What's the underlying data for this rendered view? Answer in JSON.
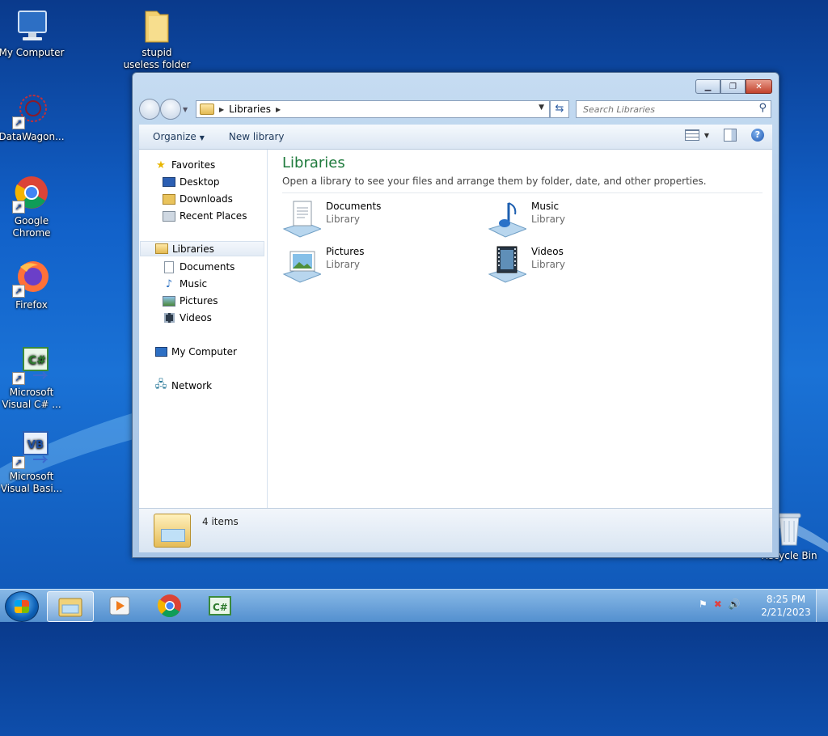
{
  "desktop": {
    "icons": {
      "my_computer": "My Computer",
      "folder": "stupid useless folder",
      "datawagon": "DataWagon...",
      "chrome": "Google Chrome",
      "firefox": "Firefox",
      "csharp": "Microsoft Visual C# ...",
      "vb": "Microsoft Visual Basi...",
      "recycle_bin": "Recycle Bin"
    }
  },
  "explorer": {
    "address": {
      "crumb": "Libraries"
    },
    "search": {
      "placeholder": "Search Libraries"
    },
    "toolbar": {
      "organize": "Organize",
      "new_library": "New library"
    },
    "nav": {
      "favorites": "Favorites",
      "desktop": "Desktop",
      "downloads": "Downloads",
      "recent_places": "Recent Places",
      "libraries": "Libraries",
      "documents": "Documents",
      "music": "Music",
      "pictures": "Pictures",
      "videos": "Videos",
      "my_computer": "My Computer",
      "network": "Network"
    },
    "content": {
      "title": "Libraries",
      "subtitle": "Open a library to see your files and arrange them by folder, date, and other properties.",
      "items": [
        {
          "name": "Documents",
          "type": "Library"
        },
        {
          "name": "Music",
          "type": "Library"
        },
        {
          "name": "Pictures",
          "type": "Library"
        },
        {
          "name": "Videos",
          "type": "Library"
        }
      ]
    },
    "status": {
      "count": "4 items"
    }
  },
  "taskbar": {
    "clock": {
      "time": "8:25 PM",
      "date": "2/21/2023"
    }
  },
  "colors": {
    "title_green": "#1e7a3c",
    "desktop_blue": "#1160c8"
  }
}
